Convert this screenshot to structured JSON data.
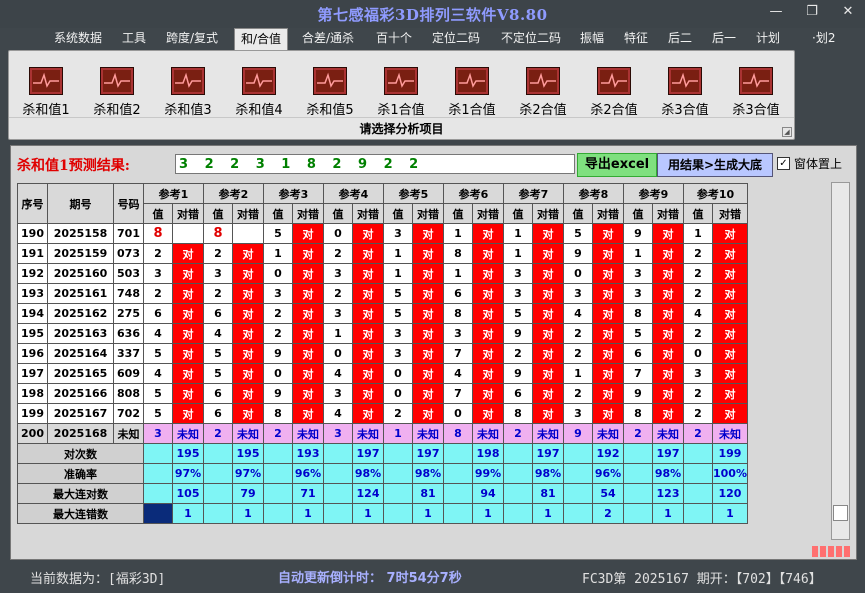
{
  "window": {
    "title": "第七感福彩3D排列三软件V8.80",
    "minimize": "—",
    "restore": "❐",
    "close": "✕"
  },
  "menu": [
    "系统数据",
    "工具",
    "跨度/复式",
    "和/合值",
    "合差/通杀",
    "百十个",
    "定位二码",
    "不定位二码",
    "振幅",
    "特征",
    "后二",
    "后一",
    "计划",
    "·划2"
  ],
  "menu_active": "和/合值",
  "ribbon": {
    "items": [
      "杀和值1",
      "杀和值2",
      "杀和值3",
      "杀和值4",
      "杀和值5",
      "杀1合值",
      "杀1合值",
      "杀2合值",
      "杀2合值",
      "杀3合值",
      "杀3合值"
    ],
    "caption": "请选择分析项目"
  },
  "prediction": {
    "label": "杀和值1预测结果:",
    "value": "3 2 2 3 1 8 2 9 2 2"
  },
  "buttons": {
    "export": "导出excel",
    "apply": "用结果>生成大底"
  },
  "topmost": {
    "label": "窗体置上",
    "checked": "✓"
  },
  "table": {
    "h_seq": "序号",
    "h_period": "期号",
    "h_num": "号码",
    "refs": [
      "参考1",
      "参考2",
      "参考3",
      "参考4",
      "参考5",
      "参考6",
      "参考7",
      "参考8",
      "参考9",
      "参考10"
    ],
    "sub_val": "值",
    "sub_res": "对错",
    "rows": [
      {
        "seq": "190",
        "period": "2025158",
        "num": "701",
        "v": [
          "8",
          "8",
          "5",
          "0",
          "3",
          "1",
          "1",
          "5",
          "9",
          "1"
        ],
        "r": [
          "",
          "",
          "对",
          "对",
          "对",
          "对",
          "对",
          "对",
          "对",
          "对"
        ],
        "hit": [
          1,
          1,
          0,
          0,
          0,
          0,
          0,
          0,
          0,
          0
        ]
      },
      {
        "seq": "191",
        "period": "2025159",
        "num": "073",
        "v": [
          "2",
          "2",
          "1",
          "2",
          "1",
          "8",
          "1",
          "9",
          "1",
          "2"
        ],
        "r": [
          "对",
          "对",
          "对",
          "对",
          "对",
          "对",
          "对",
          "对",
          "对",
          "对"
        ],
        "hit": [
          0,
          0,
          0,
          0,
          0,
          0,
          0,
          0,
          0,
          0
        ]
      },
      {
        "seq": "192",
        "period": "2025160",
        "num": "503",
        "v": [
          "3",
          "3",
          "0",
          "3",
          "1",
          "1",
          "3",
          "0",
          "3",
          "2"
        ],
        "r": [
          "对",
          "对",
          "对",
          "对",
          "对",
          "对",
          "对",
          "对",
          "对",
          "对"
        ],
        "hit": [
          0,
          0,
          0,
          0,
          0,
          0,
          0,
          0,
          0,
          0
        ]
      },
      {
        "seq": "193",
        "period": "2025161",
        "num": "748",
        "v": [
          "2",
          "2",
          "3",
          "2",
          "5",
          "6",
          "3",
          "3",
          "3",
          "2"
        ],
        "r": [
          "对",
          "对",
          "对",
          "对",
          "对",
          "对",
          "对",
          "对",
          "对",
          "对"
        ],
        "hit": [
          0,
          0,
          0,
          0,
          0,
          0,
          0,
          0,
          0,
          0
        ]
      },
      {
        "seq": "194",
        "period": "2025162",
        "num": "275",
        "v": [
          "6",
          "6",
          "2",
          "3",
          "5",
          "8",
          "5",
          "4",
          "8",
          "4"
        ],
        "r": [
          "对",
          "对",
          "对",
          "对",
          "对",
          "对",
          "对",
          "对",
          "对",
          "对"
        ],
        "hit": [
          0,
          0,
          0,
          0,
          0,
          0,
          0,
          0,
          0,
          0
        ]
      },
      {
        "seq": "195",
        "period": "2025163",
        "num": "636",
        "v": [
          "4",
          "4",
          "2",
          "1",
          "3",
          "3",
          "9",
          "2",
          "5",
          "2"
        ],
        "r": [
          "对",
          "对",
          "对",
          "对",
          "对",
          "对",
          "对",
          "对",
          "对",
          "对"
        ],
        "hit": [
          0,
          0,
          0,
          0,
          0,
          0,
          0,
          0,
          0,
          0
        ]
      },
      {
        "seq": "196",
        "period": "2025164",
        "num": "337",
        "v": [
          "5",
          "5",
          "9",
          "0",
          "3",
          "7",
          "2",
          "2",
          "6",
          "0"
        ],
        "r": [
          "对",
          "对",
          "对",
          "对",
          "对",
          "对",
          "对",
          "对",
          "对",
          "对"
        ],
        "hit": [
          0,
          0,
          0,
          0,
          0,
          0,
          0,
          0,
          0,
          0
        ]
      },
      {
        "seq": "197",
        "period": "2025165",
        "num": "609",
        "v": [
          "4",
          "5",
          "0",
          "4",
          "0",
          "4",
          "9",
          "1",
          "7",
          "3"
        ],
        "r": [
          "对",
          "对",
          "对",
          "对",
          "对",
          "对",
          "对",
          "对",
          "对",
          "对"
        ],
        "hit": [
          0,
          0,
          0,
          0,
          0,
          0,
          0,
          0,
          0,
          0
        ]
      },
      {
        "seq": "198",
        "period": "2025166",
        "num": "808",
        "v": [
          "5",
          "6",
          "9",
          "3",
          "0",
          "7",
          "6",
          "2",
          "9",
          "2"
        ],
        "r": [
          "对",
          "对",
          "对",
          "对",
          "对",
          "对",
          "对",
          "对",
          "对",
          "对"
        ],
        "hit": [
          0,
          0,
          0,
          0,
          0,
          0,
          0,
          0,
          0,
          0
        ]
      },
      {
        "seq": "199",
        "period": "2025167",
        "num": "702",
        "v": [
          "5",
          "6",
          "8",
          "4",
          "2",
          "0",
          "8",
          "3",
          "8",
          "2"
        ],
        "r": [
          "对",
          "对",
          "对",
          "对",
          "对",
          "对",
          "对",
          "对",
          "对",
          "对"
        ],
        "hit": [
          0,
          0,
          0,
          0,
          0,
          0,
          0,
          0,
          0,
          0
        ]
      }
    ],
    "pred_row": {
      "seq": "200",
      "period": "2025168",
      "num": "未知",
      "v": [
        "3",
        "2",
        "2",
        "3",
        "1",
        "8",
        "2",
        "9",
        "2",
        "2"
      ],
      "r": [
        "未知",
        "未知",
        "未知",
        "未知",
        "未知",
        "未知",
        "未知",
        "未知",
        "未知",
        "未知"
      ]
    },
    "stats": [
      {
        "label": "对次数",
        "values": [
          "195",
          "195",
          "193",
          "197",
          "197",
          "198",
          "197",
          "192",
          "197",
          "199"
        ]
      },
      {
        "label": "准确率",
        "values": [
          "97%",
          "97%",
          "96%",
          "98%",
          "98%",
          "99%",
          "98%",
          "96%",
          "98%",
          "100%"
        ]
      },
      {
        "label": "最大连对数",
        "values": [
          "105",
          "79",
          "71",
          "124",
          "81",
          "94",
          "81",
          "54",
          "123",
          "120"
        ]
      },
      {
        "label": "最大连错数",
        "values": [
          "1",
          "1",
          "1",
          "1",
          "1",
          "1",
          "1",
          "2",
          "1",
          "1"
        ]
      }
    ]
  },
  "status": {
    "current": "当前数据为：[福彩3D]",
    "countdown": "自动更新倒计时： 7时54分7秒",
    "issue": "FC3D第 2025167 期开：【702】【746】"
  }
}
